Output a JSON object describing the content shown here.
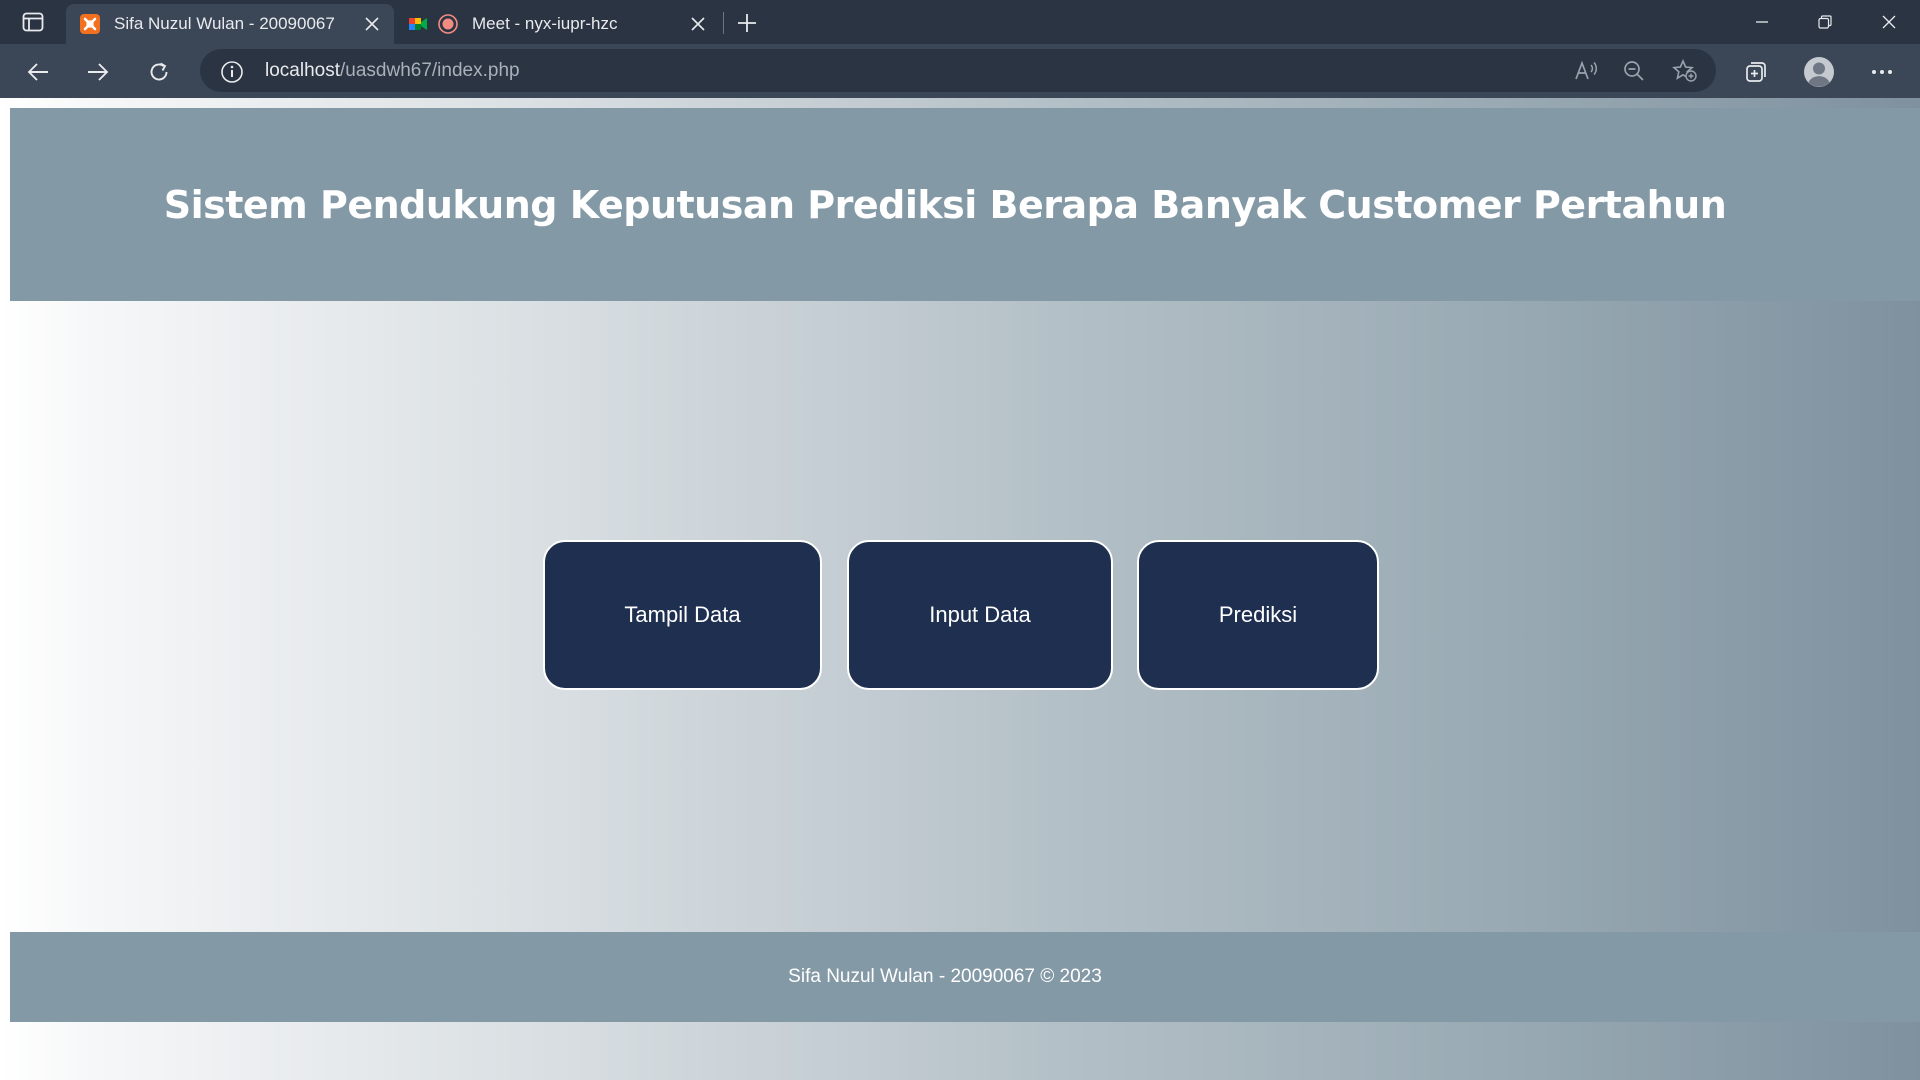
{
  "browser": {
    "tabs": [
      {
        "title": "Sifa Nuzul Wulan - 20090067",
        "active": true,
        "icon": "xampp-icon"
      },
      {
        "title": "Meet - nyx-iupr-hzc",
        "active": false,
        "icon": "google-meet-icon"
      }
    ],
    "address": {
      "host": "localhost",
      "path": "/uasdwh67/index.php"
    }
  },
  "page": {
    "header_title": "Sistem Pendukung Keputusan Prediksi Berapa Banyak Customer Pertahun",
    "buttons": {
      "tampil": "Tampil Data",
      "input": "Input Data",
      "prediksi": "Prediksi"
    },
    "footer": "Sifa Nuzul Wulan - 20090067 © 2023"
  },
  "colors": {
    "header_bg": "#8499a6",
    "button_bg": "#1f2f50",
    "browser_chrome": "#2b3442",
    "toolbar": "#3b4656"
  }
}
